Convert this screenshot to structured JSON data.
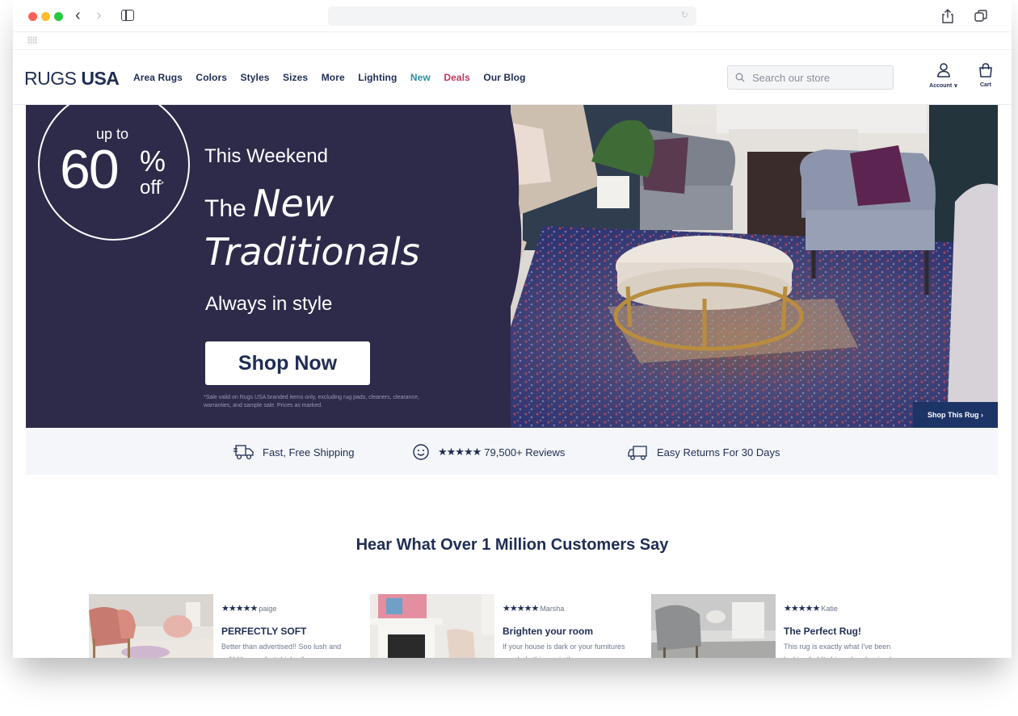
{
  "browser": {
    "address_text": ""
  },
  "header": {
    "logo_part1": "RUGS ",
    "logo_part2": "USA",
    "nav": [
      "Area Rugs",
      "Colors",
      "Styles",
      "Sizes",
      "More",
      "Lighting",
      "New",
      "Deals",
      "Our Blog"
    ],
    "search_placeholder": "Search our store",
    "account_label": "Account",
    "cart_label": "Cart"
  },
  "hero": {
    "badge_upto": "up to",
    "badge_number": "60",
    "badge_pct": "%",
    "badge_off": "off",
    "badge_asterisk": "*",
    "kicker": "This Weekend",
    "title_the": "The ",
    "title_new": "New",
    "title_traditionals": "Traditionals",
    "subtitle": "Always in style",
    "cta": "Shop Now",
    "disclaimer": "*Sale valid on Rugs USA branded items only, excluding rug pads, cleaners, clearance, warranties, and sample sale. Prices as marked.",
    "shop_rug": "Shop This Rug"
  },
  "trust": {
    "shipping": "Fast, Free Shipping",
    "reviews_stars": "★★★★★",
    "reviews": "79,500+ Reviews",
    "returns": "Easy Returns For 30 Days"
  },
  "reviews": {
    "heading": "Hear What Over 1 Million Customers Say",
    "items": [
      {
        "stars": "★★★★★",
        "author": "paige",
        "title": "PERFECTLY SOFT",
        "text": "Better than advertised!! Soo lush and soft! It's a perfect, high-pile"
      },
      {
        "stars": "★★★★★",
        "author": "Marsha",
        "title": "Brighten your room",
        "text": "If your house is dark or your furnitures are dark, this rug is the"
      },
      {
        "stars": "★★★★★",
        "author": "Katie",
        "title": "The Perfect Rug!",
        "text": "This rug is exactly what I've been looking for! It shipped and arrived"
      }
    ]
  },
  "colors": {
    "navy": "#1f2d54",
    "hero_panel": "#2d2a4a",
    "new": "#2f8fa3",
    "deals": "#c2375c"
  }
}
